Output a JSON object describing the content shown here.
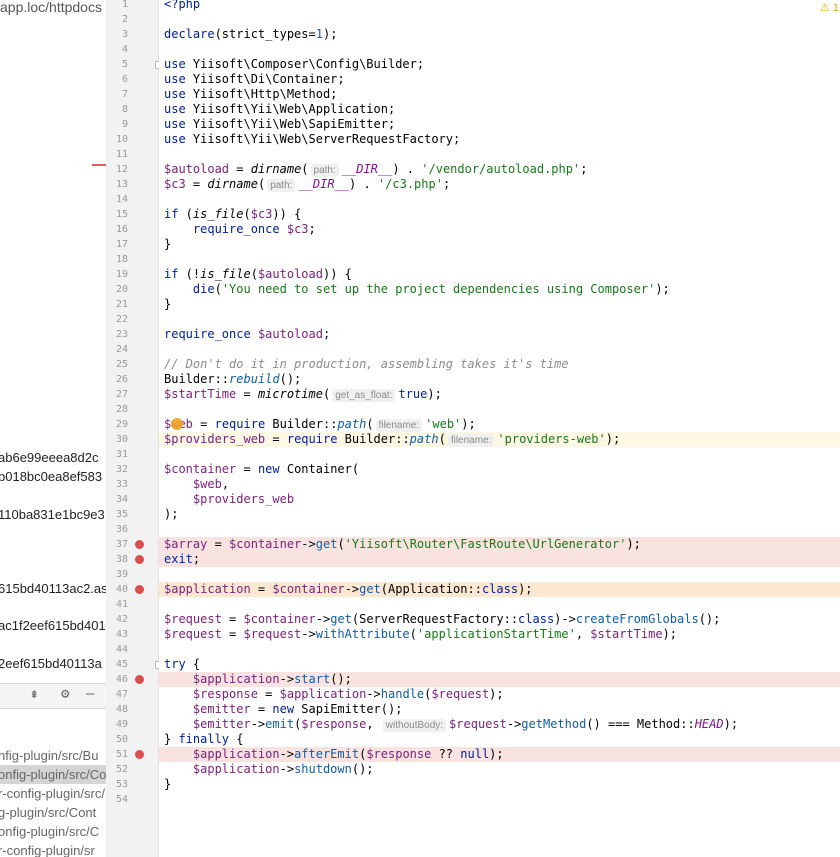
{
  "left_panel": {
    "path_text": "app.loc/httpdocs",
    "hashes": [
      "ab6e99eeea8d2c",
      "b018bc0ea8ef583",
      "110ba831e1bc9e3",
      "615bd40113ac2.as",
      "ac1f2eef615bd401",
      "2eef615bd40113a"
    ],
    "toolbar_icons": [
      "⇞",
      "⚙",
      "—"
    ],
    "files": [
      "nfig-plugin/src/Bu",
      "onfig-plugin/src/Co",
      "r-config-plugin/src/",
      "g-plugin/src/Cont",
      "onfig-plugin/src/C",
      "r-config-plugin/sr"
    ]
  },
  "editor": {
    "warning_badge": "⚠ 1",
    "lines": [
      {
        "n": "1",
        "html": "<span class=\"kw\">&lt;?php</span>"
      },
      {
        "n": "2",
        "html": ""
      },
      {
        "n": "3",
        "html": "<span class=\"kw\">declare</span>(strict_types=<span class=\"num\">1</span>);"
      },
      {
        "n": "4",
        "html": ""
      },
      {
        "n": "5",
        "html": "<span class=\"kw\">use</span> Yiisoft\\Composer\\Config\\Builder;"
      },
      {
        "n": "6",
        "html": "<span class=\"kw\">use</span> Yiisoft\\Di\\Container;"
      },
      {
        "n": "7",
        "html": "<span class=\"kw\">use</span> Yiisoft\\Http\\Method;"
      },
      {
        "n": "8",
        "html": "<span class=\"kw\">use</span> Yiisoft\\Yii\\Web\\Application;"
      },
      {
        "n": "9",
        "html": "<span class=\"kw\">use</span> Yiisoft\\Yii\\Web\\SapiEmitter;"
      },
      {
        "n": "10",
        "html": "<span class=\"kw\">use</span> Yiisoft\\Yii\\Web\\ServerRequestFactory;"
      },
      {
        "n": "11",
        "html": ""
      },
      {
        "n": "12",
        "html": "<span class=\"var\">$autoload</span> = <span class=\"fn-it\">dirname</span>(<span class=\"hint\">path:</span><span class=\"const\">__DIR__</span>) . <span class=\"str\">'/vendor/autoload.php'</span>;"
      },
      {
        "n": "13",
        "html": "<span class=\"var\">$c3</span> = <span class=\"fn-it\">dirname</span>(<span class=\"hint\">path:</span><span class=\"const\">__DIR__</span>) . <span class=\"str\">'/c3.php'</span>;"
      },
      {
        "n": "14",
        "html": ""
      },
      {
        "n": "15",
        "html": "<span class=\"kw\">if</span> (<span class=\"fn-it\">is_file</span>(<span class=\"var\">$c3</span>)) {"
      },
      {
        "n": "16",
        "html": "    <span class=\"kw\">require_once</span> <span class=\"var\">$c3</span>;"
      },
      {
        "n": "17",
        "html": "}"
      },
      {
        "n": "18",
        "html": ""
      },
      {
        "n": "19",
        "html": "<span class=\"kw\">if</span> (!<span class=\"fn-it\">is_file</span>(<span class=\"var\">$autoload</span>)) {"
      },
      {
        "n": "20",
        "html": "    <span class=\"kw\">die</span>(<span class=\"str\">'You need to set up the project dependencies using Composer'</span>);"
      },
      {
        "n": "21",
        "html": "}"
      },
      {
        "n": "22",
        "html": ""
      },
      {
        "n": "23",
        "html": "<span class=\"kw\">require_once</span> <span class=\"var\">$autoload</span>;"
      },
      {
        "n": "24",
        "html": ""
      },
      {
        "n": "25",
        "html": "<span class=\"cm\">// Don't do it in production, assembling takes it's time</span>"
      },
      {
        "n": "26",
        "html": "Builder::<span class=\"meth fn-it\">rebuild</span>();"
      },
      {
        "n": "27",
        "html": "<span class=\"var\">$startTime</span> = <span class=\"fn-it\">microtime</span>(<span class=\"hint\">get_as_float:</span><span class=\"kw\">true</span>);"
      },
      {
        "n": "28",
        "html": ""
      },
      {
        "n": "29",
        "html": "<span class=\"var\">$web</span> = <span class=\"kw\">require</span> Builder::<span class=\"meth fn-it\">path</span>(<span class=\"hint\">filename:</span><span class=\"str\">'web'</span>);"
      },
      {
        "n": "30",
        "html": "<span class=\"var\">$providers_web</span> = <span class=\"kw\">require</span> Builder::<span class=\"meth fn-it\">path</span>(<span class=\"hint\">filename:</span><span class=\"str\">'providers-web'</span>);"
      },
      {
        "n": "31",
        "html": ""
      },
      {
        "n": "32",
        "html": "<span class=\"var\">$container</span> = <span class=\"kw\">new</span> Container("
      },
      {
        "n": "33",
        "html": "    <span class=\"var\">$web</span>,"
      },
      {
        "n": "34",
        "html": "    <span class=\"var\">$providers_web</span>"
      },
      {
        "n": "35",
        "html": ");"
      },
      {
        "n": "36",
        "html": ""
      },
      {
        "n": "37",
        "html": "<span class=\"var\">$array</span> = <span class=\"var\">$container</span>-&gt;<span class=\"meth\">get</span>(<span class=\"str\">'Yiisoft\\Router\\FastRoute\\UrlGenerator'</span>);"
      },
      {
        "n": "38",
        "html": "<span class=\"kw\">exit</span>;"
      },
      {
        "n": "39",
        "html": ""
      },
      {
        "n": "40",
        "html": "<span class=\"var\">$application</span> = <span class=\"var\">$container</span>-&gt;<span class=\"meth\">get</span>(Application::<span class=\"kw\">class</span>);"
      },
      {
        "n": "41",
        "html": ""
      },
      {
        "n": "42",
        "html": "<span class=\"var\">$request</span> = <span class=\"var\">$container</span>-&gt;<span class=\"meth\">get</span>(ServerRequestFactory::<span class=\"kw\">class</span>)-&gt;<span class=\"meth\">createFromGlobals</span>();"
      },
      {
        "n": "43",
        "html": "<span class=\"var\">$request</span> = <span class=\"var\">$request</span>-&gt;<span class=\"meth\">withAttribute</span>(<span class=\"str\">'applicationStartTime'</span>, <span class=\"var\">$startTime</span>);"
      },
      {
        "n": "44",
        "html": ""
      },
      {
        "n": "45",
        "html": "<span class=\"kw\">try</span> {"
      },
      {
        "n": "46",
        "html": "    <span class=\"var\">$application</span>-&gt;<span class=\"meth\">start</span>();"
      },
      {
        "n": "47",
        "html": "    <span class=\"var\">$response</span> = <span class=\"var\">$application</span>-&gt;<span class=\"meth\">handle</span>(<span class=\"var\">$request</span>);"
      },
      {
        "n": "48",
        "html": "    <span class=\"var\">$emitter</span> = <span class=\"kw\">new</span> SapiEmitter();"
      },
      {
        "n": "49",
        "html": "    <span class=\"var\">$emitter</span>-&gt;<span class=\"meth\">emit</span>(<span class=\"var\">$response</span>, <span class=\"hint\">withoutBody:</span><span class=\"var\">$request</span>-&gt;<span class=\"meth\">getMethod</span>() === Method::<span class=\"const\">HEAD</span>);"
      },
      {
        "n": "50",
        "html": "} <span class=\"kw\">finally</span> {"
      },
      {
        "n": "51",
        "html": "    <span class=\"var\">$application</span>-&gt;<span class=\"meth\">afterEmit</span>(<span class=\"var\">$response</span> ?? <span class=\"kw\">null</span>);"
      },
      {
        "n": "52",
        "html": "    <span class=\"var\">$application</span>-&gt;<span class=\"meth\">shutdown</span>();"
      },
      {
        "n": "53",
        "html": "}"
      },
      {
        "n": "54",
        "html": ""
      }
    ],
    "breakpoint_lines": [
      37,
      38,
      40,
      46,
      51
    ],
    "bp_highlight_lines": [
      37,
      38,
      46,
      51
    ],
    "exec_line": 40,
    "current_line": 30,
    "fold_lines": [
      5,
      45
    ]
  }
}
